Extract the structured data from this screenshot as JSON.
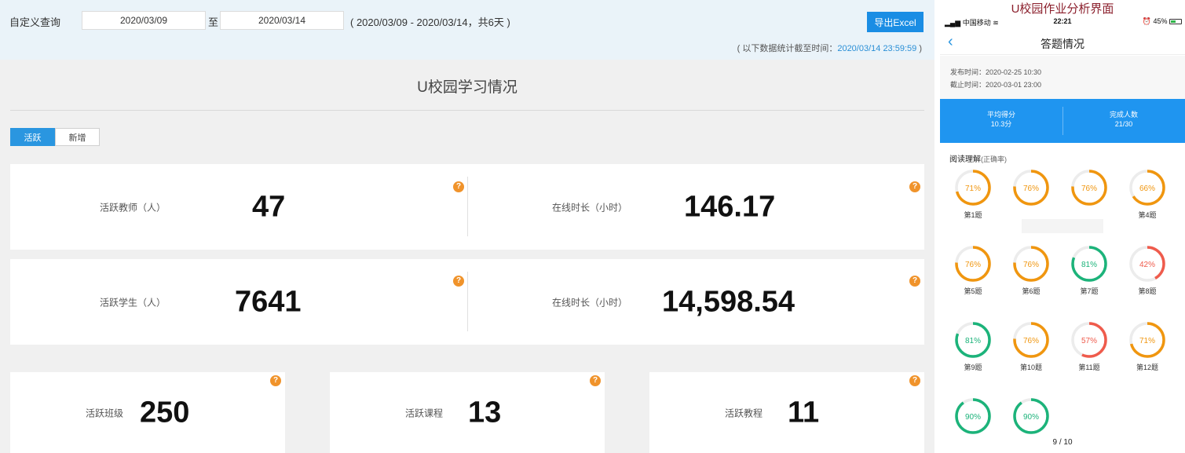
{
  "filter": {
    "label": "自定义查询",
    "start_date": "2020/03/09",
    "to": "至",
    "end_date": "2020/03/14",
    "range_text": "( 2020/03/09 - 2020/03/14，共6天 )",
    "export_label": "导出Excel",
    "asof_prefix": "( 以下数据统计截至时间：",
    "asof_time": "2020/03/14 23:59:59",
    "asof_suffix": " )"
  },
  "page_title": "U校园学习情况",
  "tabs": [
    {
      "label": "活跃",
      "active": true
    },
    {
      "label": "新增",
      "active": false
    }
  ],
  "teachers": {
    "label": "活跃教师（人）",
    "value": "47",
    "online_label": "在线时长（小时）",
    "online_value": "146.17"
  },
  "students": {
    "label": "活跃学生（人）",
    "value": "7641",
    "online_label": "在线时长（小时）",
    "online_value": "14,598.54"
  },
  "small_cards": [
    {
      "label": "活跃班级",
      "value": "250"
    },
    {
      "label": "活跃课程",
      "value": "13"
    },
    {
      "label": "活跃教程",
      "value": "11"
    }
  ],
  "help_glyph": "?",
  "phone": {
    "caption": "U校园作业分析界面",
    "status": {
      "carrier": "中国移动",
      "time": "22:21",
      "battery": "45%",
      "battery_level": 0.45
    },
    "nav_title": "答题情况",
    "back_glyph": "‹",
    "publish_time": "发布时间：2020-02-25 10:30",
    "deadline": "截止时间：2020-03-01 23:00",
    "avg_label": "平均得分",
    "avg_value": "10.3分",
    "done_label": "完成人数",
    "done_value": "21/30",
    "section_title": "阅读理解",
    "section_sub": "(正确率)",
    "pager": "9 / 10",
    "questions": [
      {
        "label": "第1题",
        "pct": 71,
        "color": "#f0960f"
      },
      {
        "label": "",
        "pct": 76,
        "color": "#f0960f"
      },
      {
        "label": "",
        "pct": 76,
        "color": "#f0960f"
      },
      {
        "label": "第4题",
        "pct": 66,
        "color": "#f0960f"
      },
      {
        "label": "第5题",
        "pct": 76,
        "color": "#f0960f"
      },
      {
        "label": "第6题",
        "pct": 76,
        "color": "#f0960f"
      },
      {
        "label": "第7题",
        "pct": 81,
        "color": "#1cb37a"
      },
      {
        "label": "第8题",
        "pct": 42,
        "color": "#ef5b4c"
      },
      {
        "label": "第9题",
        "pct": 81,
        "color": "#1cb37a"
      },
      {
        "label": "第10题",
        "pct": 76,
        "color": "#f0960f"
      },
      {
        "label": "第11题",
        "pct": 57,
        "color": "#ef5b4c"
      },
      {
        "label": "第12题",
        "pct": 71,
        "color": "#f0960f"
      },
      {
        "label": "",
        "pct": 90,
        "color": "#1cb37a"
      },
      {
        "label": "",
        "pct": 90,
        "color": "#1cb37a"
      }
    ]
  }
}
